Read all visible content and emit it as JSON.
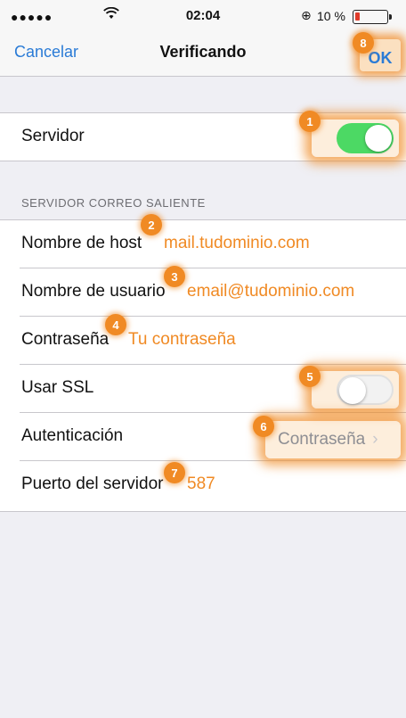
{
  "status_bar": {
    "signal": "●●●●●",
    "time": "02:04",
    "battery": "10 %",
    "wifi_icon": "wifi-icon",
    "lock_icon": "orientation-lock-icon"
  },
  "nav": {
    "cancel_label": "Cancelar",
    "title": "Verificando",
    "ok_label": "OK"
  },
  "server_section": {
    "server_label": "Servidor",
    "server_enabled": true
  },
  "outgoing_section": {
    "header": "SERVIDOR CORREO SALIENTE",
    "rows": [
      {
        "label": "Nombre de host",
        "value": "mail.tudominio.com"
      },
      {
        "label": "Nombre de usuario",
        "value": "email@tudominio.com"
      },
      {
        "label": "Contraseña",
        "value": "Tu contraseña"
      },
      {
        "label": "Usar SSL",
        "value": ""
      },
      {
        "label": "Autenticación",
        "value": "Contraseña"
      },
      {
        "label": "Puerto del servidor",
        "value": "587"
      }
    ],
    "use_ssl": false
  },
  "badges": [
    "1",
    "2",
    "3",
    "4",
    "5",
    "6",
    "7",
    "8"
  ],
  "colors": {
    "accent_blue": "#2a7bd6",
    "highlight_orange": "#f08a24",
    "toggle_green": "#4cd964"
  }
}
